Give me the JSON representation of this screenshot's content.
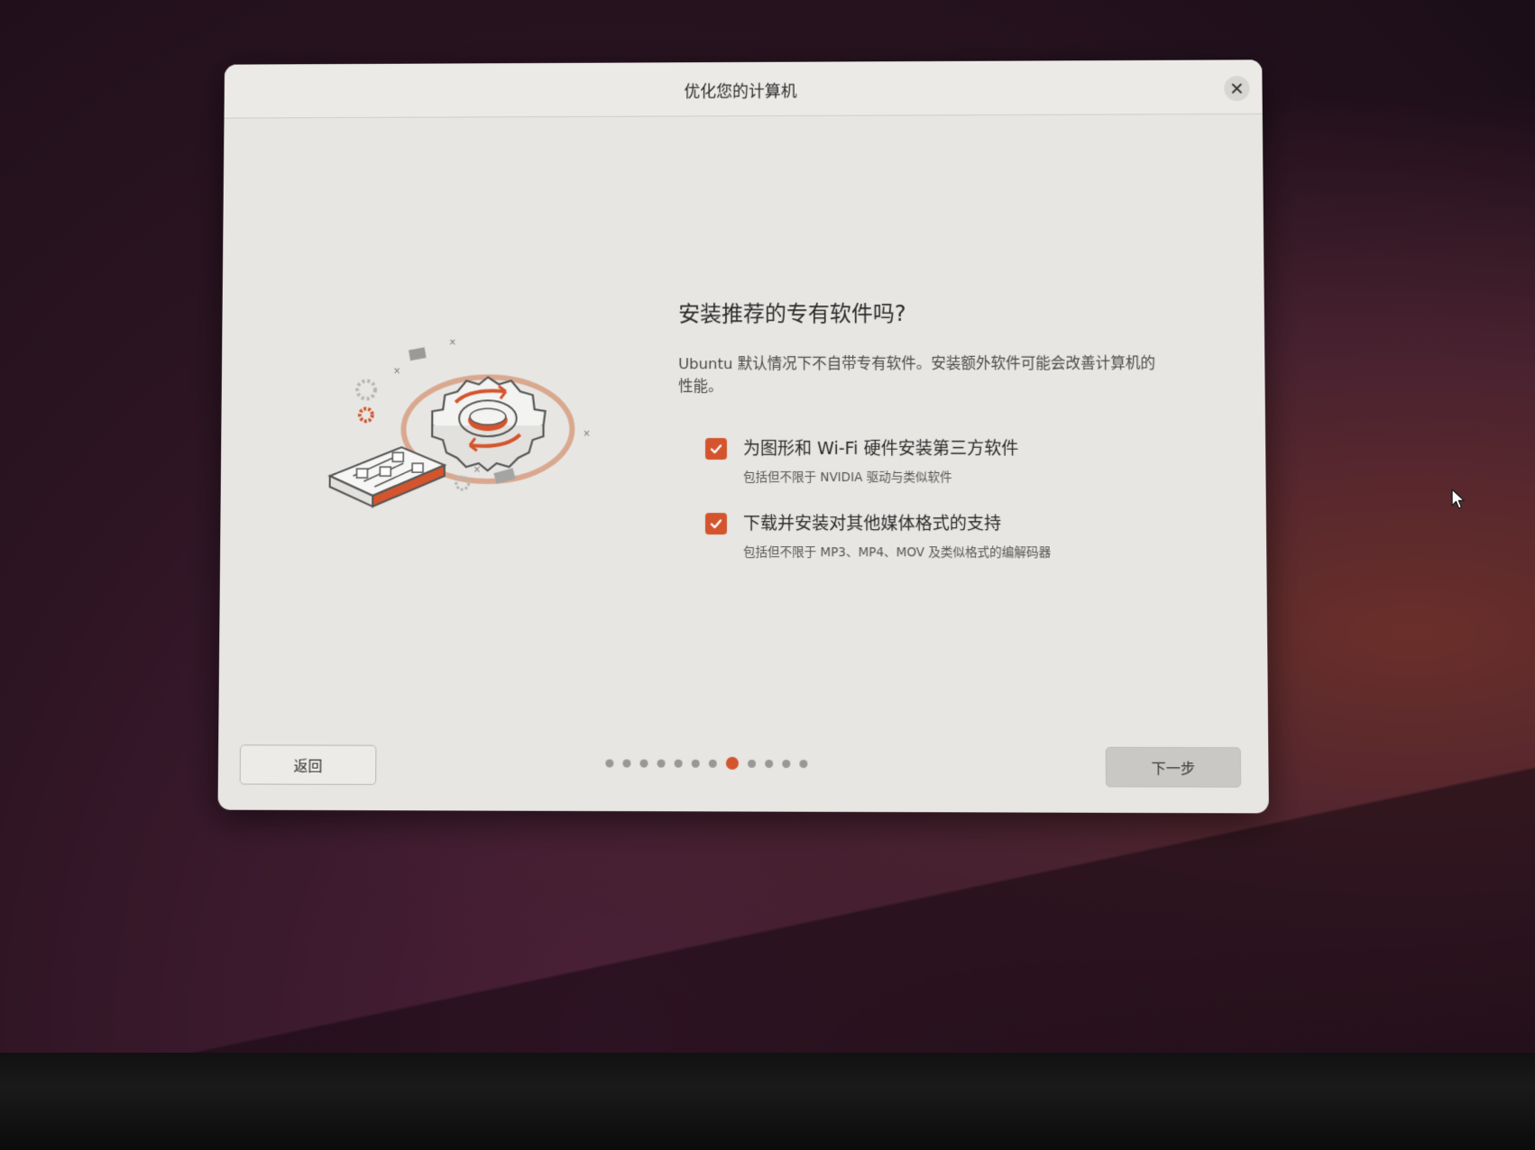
{
  "window": {
    "title": "优化您的计算机"
  },
  "main": {
    "heading": "安装推荐的专有软件吗?",
    "description": "Ubuntu 默认情况下不自带专有软件。安装额外软件可能会改善计算机的性能。",
    "options": [
      {
        "label": "为图形和 Wi-Fi 硬件安装第三方软件",
        "sublabel": "包括但不限于 NVIDIA 驱动与类似软件",
        "checked": true
      },
      {
        "label": "下载并安装对其他媒体格式的支持",
        "sublabel": "包括但不限于 MP3、MP4、MOV 及类似格式的编解码器",
        "checked": true
      }
    ]
  },
  "footer": {
    "back_label": "返回",
    "next_label": "下一步",
    "progress": {
      "total_steps": 12,
      "current_step": 8
    }
  },
  "colors": {
    "accent": "#d4542d",
    "dialog_bg": "#e7e6e3"
  },
  "icons": [
    "close-icon",
    "checkmark-icon",
    "gear-illustration",
    "mouse-cursor-icon"
  ]
}
